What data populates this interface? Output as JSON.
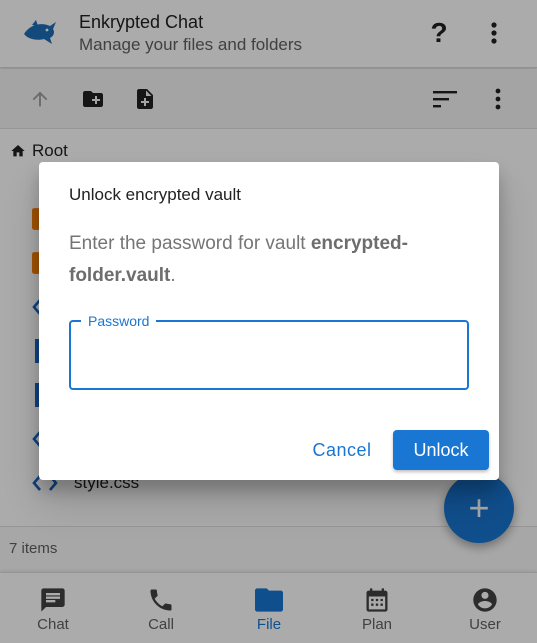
{
  "header": {
    "title": "Enkrypted Chat",
    "subtitle": "Manage your files and folders",
    "help_label": "?",
    "logo_icon": "dolphin-logo-icon",
    "menu_icon": "more-vert-icon"
  },
  "toolbar": {
    "icons": [
      "arrow-up-icon",
      "create-folder-icon",
      "create-file-icon",
      "sort-icon",
      "more-vert-icon"
    ]
  },
  "breadcrumb": {
    "icon": "home-icon",
    "label": "Root"
  },
  "files": {
    "items": [
      {
        "icon": "folder-icon",
        "name": ""
      },
      {
        "icon": "folder-icon",
        "name": ""
      },
      {
        "icon": "code-icon",
        "name": ""
      },
      {
        "icon": "file-icon",
        "name": ""
      },
      {
        "icon": "file-icon",
        "name": ""
      },
      {
        "icon": "code-icon",
        "name": ""
      },
      {
        "icon": "code-icon",
        "name": "style.css"
      }
    ],
    "count_label": "7 items"
  },
  "fab": {
    "label": "+"
  },
  "nav": {
    "items": [
      {
        "label": "Chat",
        "icon": "chat-icon",
        "active": false
      },
      {
        "label": "Call",
        "icon": "phone-icon",
        "active": false
      },
      {
        "label": "File",
        "icon": "folder-icon",
        "active": true
      },
      {
        "label": "Plan",
        "icon": "calendar-icon",
        "active": false
      },
      {
        "label": "User",
        "icon": "account-icon",
        "active": false
      }
    ]
  },
  "dialog": {
    "title": "Unlock encrypted vault",
    "message_prefix": "Enter the password for vault ",
    "vault_name": "encrypted-folder.vault",
    "message_suffix": ".",
    "password_label": "Password",
    "password_value": "",
    "cancel_label": "Cancel",
    "unlock_label": "Unlock"
  },
  "colors": {
    "primary": "#1976d2",
    "folder": "#f57c00",
    "scrim": "rgba(0,0,0,0.33)"
  }
}
